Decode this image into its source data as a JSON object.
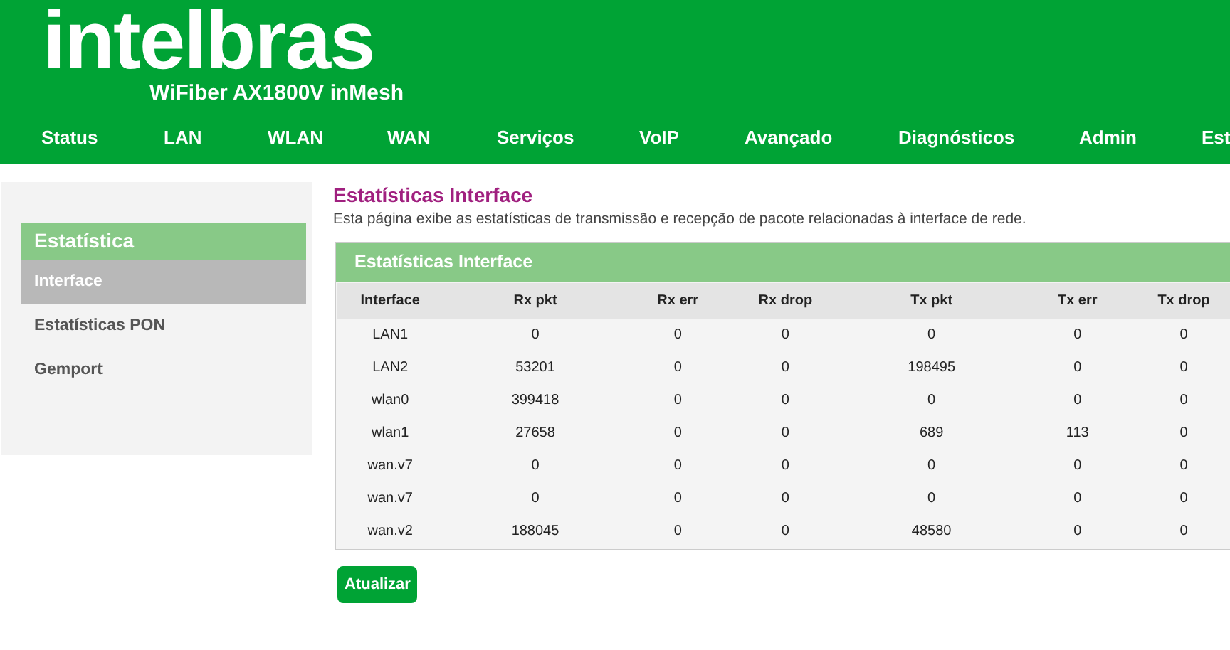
{
  "header": {
    "logo": "intelbras",
    "model": "WiFiber AX1800V inMesh"
  },
  "nav": [
    "Status",
    "LAN",
    "WLAN",
    "WAN",
    "Serviços",
    "VoIP",
    "Avançado",
    "Diagnósticos",
    "Admin",
    "Est"
  ],
  "sidebar": {
    "title": "Estatística",
    "items": [
      {
        "label": "Interface",
        "selected": true
      },
      {
        "label": "Estatísticas PON",
        "selected": false
      },
      {
        "label": "Gemport",
        "selected": false
      }
    ]
  },
  "page": {
    "title": "Estatísticas Interface",
    "description": "Esta página exibe as estatísticas de transmissão e recepção de pacote relacionadas à interface de rede."
  },
  "panel": {
    "title": "Estatísticas Interface",
    "columns": [
      "Interface",
      "Rx pkt",
      "Rx err",
      "Rx drop",
      "Tx pkt",
      "Tx err",
      "Tx drop"
    ],
    "rows": [
      [
        "LAN1",
        "0",
        "0",
        "0",
        "0",
        "0",
        "0"
      ],
      [
        "LAN2",
        "53201",
        "0",
        "0",
        "198495",
        "0",
        "0"
      ],
      [
        "wlan0",
        "399418",
        "0",
        "0",
        "0",
        "0",
        "0"
      ],
      [
        "wlan1",
        "27658",
        "0",
        "0",
        "689",
        "113",
        "0"
      ],
      [
        "wan.v7",
        "0",
        "0",
        "0",
        "0",
        "0",
        "0"
      ],
      [
        "wan.v7",
        "0",
        "0",
        "0",
        "0",
        "0",
        "0"
      ],
      [
        "wan.v2",
        "188045",
        "0",
        "0",
        "48580",
        "0",
        "0"
      ]
    ]
  },
  "buttons": [
    "Atualizar"
  ]
}
